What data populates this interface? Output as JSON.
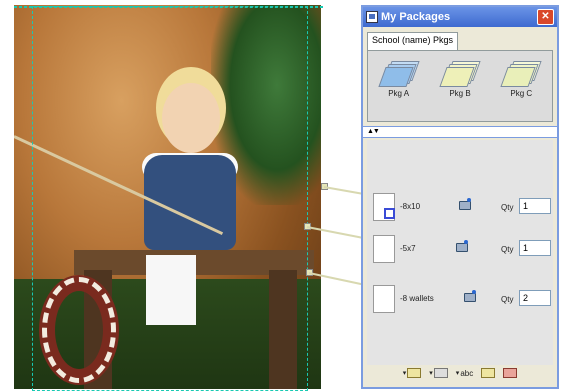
{
  "window": {
    "title": "My Packages",
    "close_symbol": "✕"
  },
  "tabs": [
    {
      "label": "School (name) Pkgs"
    }
  ],
  "packages": [
    {
      "label": "Pkg A",
      "color": "#8fbde9"
    },
    {
      "label": "Pkg B",
      "color": "#eef0b8"
    },
    {
      "label": "Pkg C",
      "color": "#e9efb9"
    }
  ],
  "splitter": {
    "arrows": "▲▼"
  },
  "items": [
    {
      "size": "-8x10",
      "qty_label": "Qty",
      "qty": "1"
    },
    {
      "size": "-5x7",
      "qty_label": "Qty",
      "qty": "1"
    },
    {
      "size": "-8 wallets",
      "qty_label": "Qty",
      "qty": "2"
    }
  ],
  "toolbar": {
    "abc_label": "abc",
    "arrow": "▾"
  },
  "colors": {
    "crop_guide": "#18c9b2",
    "title_bar": "#3e6ad0",
    "selected_frame": "#3a4bd6"
  }
}
